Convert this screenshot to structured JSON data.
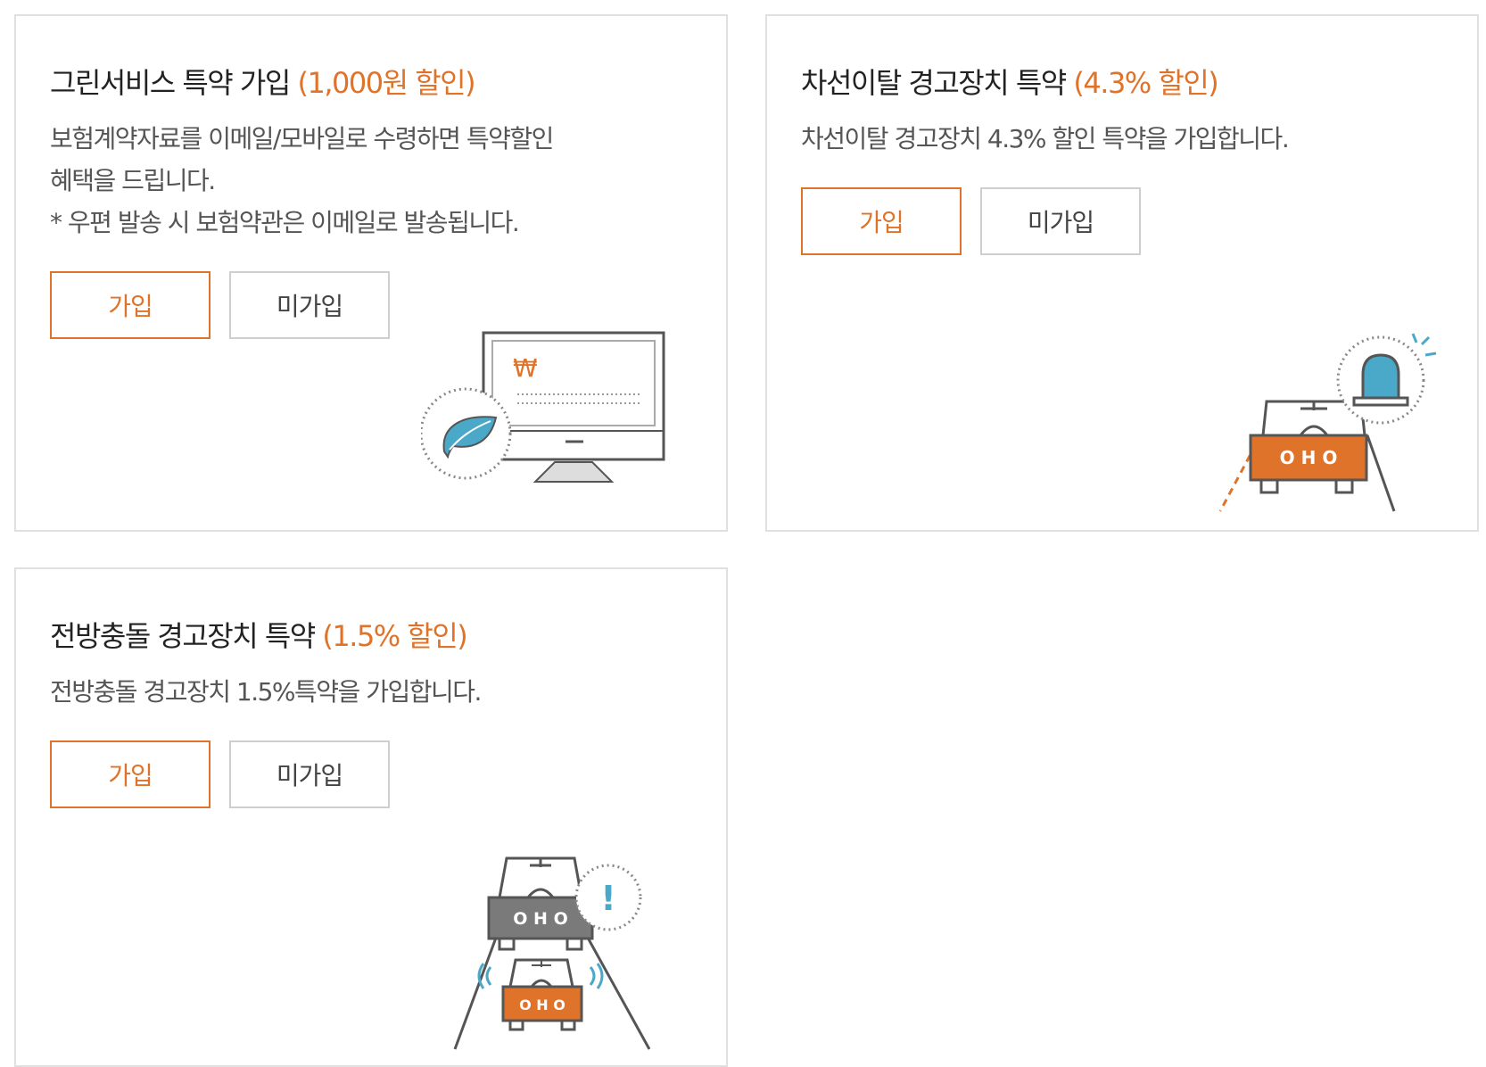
{
  "colors": {
    "accent": "#e0732a",
    "card_border": "#e0e0e0",
    "illustration_blue": "#4aa8c8",
    "illustration_gray": "#7a7a7a"
  },
  "cards": [
    {
      "title": "그린서비스 특약 가입",
      "discount": "(1,000원 할인)",
      "description": [
        "보험계약자료를 이메일/모바일로 수령하면 특약할인",
        "혜택을 드립니다.",
        "* 우편 발송 시 보험약관은 이메일로 발송됩니다."
      ],
      "join_label": "가입",
      "decline_label": "미가입",
      "illustration": {
        "icon": "monitor-leaf-icon",
        "symbol": "₩"
      }
    },
    {
      "title": "차선이탈 경고장치 특약",
      "discount": "(4.3% 할인)",
      "description": [
        "차선이탈 경고장치 4.3% 할인 특약을 가입합니다."
      ],
      "join_label": "가입",
      "decline_label": "미가입",
      "illustration": {
        "icon": "car-siren-icon",
        "plate": "O H O"
      }
    },
    {
      "title": "전방충돌 경고장치 특약",
      "discount": "(1.5% 할인)",
      "description": [
        "전방충돌 경고장치 1.5%특약을 가입합니다."
      ],
      "join_label": "가입",
      "decline_label": "미가입",
      "illustration": {
        "icon": "car-collision-warning-icon",
        "plate": "O H O",
        "alert": "!"
      }
    }
  ]
}
